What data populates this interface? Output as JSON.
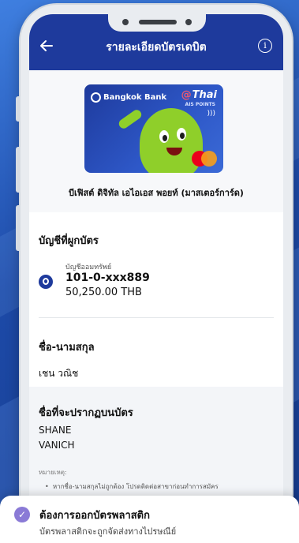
{
  "header": {
    "title": "รายละเอียดบัตรเดบิต",
    "back_icon": "arrow-left-icon",
    "info_icon": "info-icon"
  },
  "card": {
    "bank_name": "Bangkok Bank",
    "partner_brand": "Thai",
    "partner_sub": "AIS POINTS",
    "network": "mastercard",
    "product_name": "บีเฟิสต์ ดิจิทัล เอไอเอส พอยท์ (มาสเตอร์การ์ด)"
  },
  "linked_account": {
    "section_title": "บัญชีที่ผูกบัตร",
    "account_type": "บัญชีออมทรัพย์",
    "account_number": "101-0-xxx889",
    "balance": "50,250.00 THB"
  },
  "name_section": {
    "title": "ชื่อ-นามสกุล",
    "value": "เชน วณิช"
  },
  "printed_name": {
    "title": "ชื่อที่จะปรากฏบนบัตร",
    "line1": "SHANE",
    "line2": "VANICH"
  },
  "remark": {
    "label": "หมายเหตุ:",
    "item": "หากชื่อ-นามสกุลไม่ถูกต้อง โปรดติดต่อสาขาก่อนทำการสมัคร"
  },
  "bottom_sheet": {
    "check_icon": "check-circle-icon",
    "title": "ต้องการออกบัตรพลาสติก",
    "subtitle": "บัตรพลาสติกจะถูกจัดส่งทางไปรษณีย์"
  },
  "colors": {
    "header_blue": "#1e3a9c",
    "mascot_green": "#8fcf2a",
    "check_purple": "#8a7ad6"
  }
}
